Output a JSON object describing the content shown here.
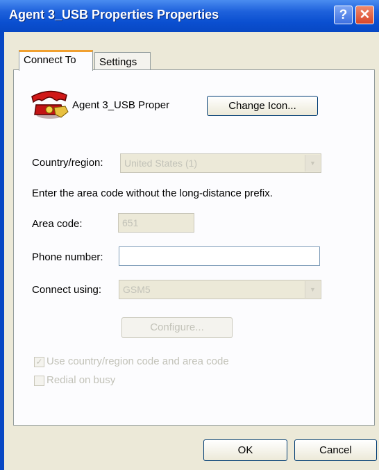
{
  "window": {
    "title": "Agent 3_USB Properties Properties",
    "help_glyph": "?",
    "close_glyph": "✕"
  },
  "tabs": [
    {
      "label": "Connect To"
    },
    {
      "label": "Settings"
    }
  ],
  "connection": {
    "name": "Agent 3_USB Proper",
    "icon": "telephone-icon"
  },
  "buttons": {
    "change_icon": "Change Icon...",
    "configure": "Configure...",
    "ok": "OK",
    "cancel": "Cancel"
  },
  "fields": {
    "country_label": "Country/region:",
    "country_value": "United States (1)",
    "instruction": "Enter the area code without the long-distance prefix.",
    "area_code_label": "Area code:",
    "area_code_value": "651",
    "phone_label": "Phone number:",
    "phone_value": "",
    "connect_using_label": "Connect using:",
    "connect_using_value": "GSM5"
  },
  "checkboxes": {
    "use_country_code": {
      "label": "Use country/region code and area code",
      "checked": true
    },
    "redial_on_busy": {
      "label": "Redial on busy",
      "checked": false
    }
  },
  "colors": {
    "titlebar": "#0a4fd0",
    "dialog_bg": "#ece9d8",
    "tab_highlight": "#f0a030",
    "close_button": "#d8462a"
  }
}
